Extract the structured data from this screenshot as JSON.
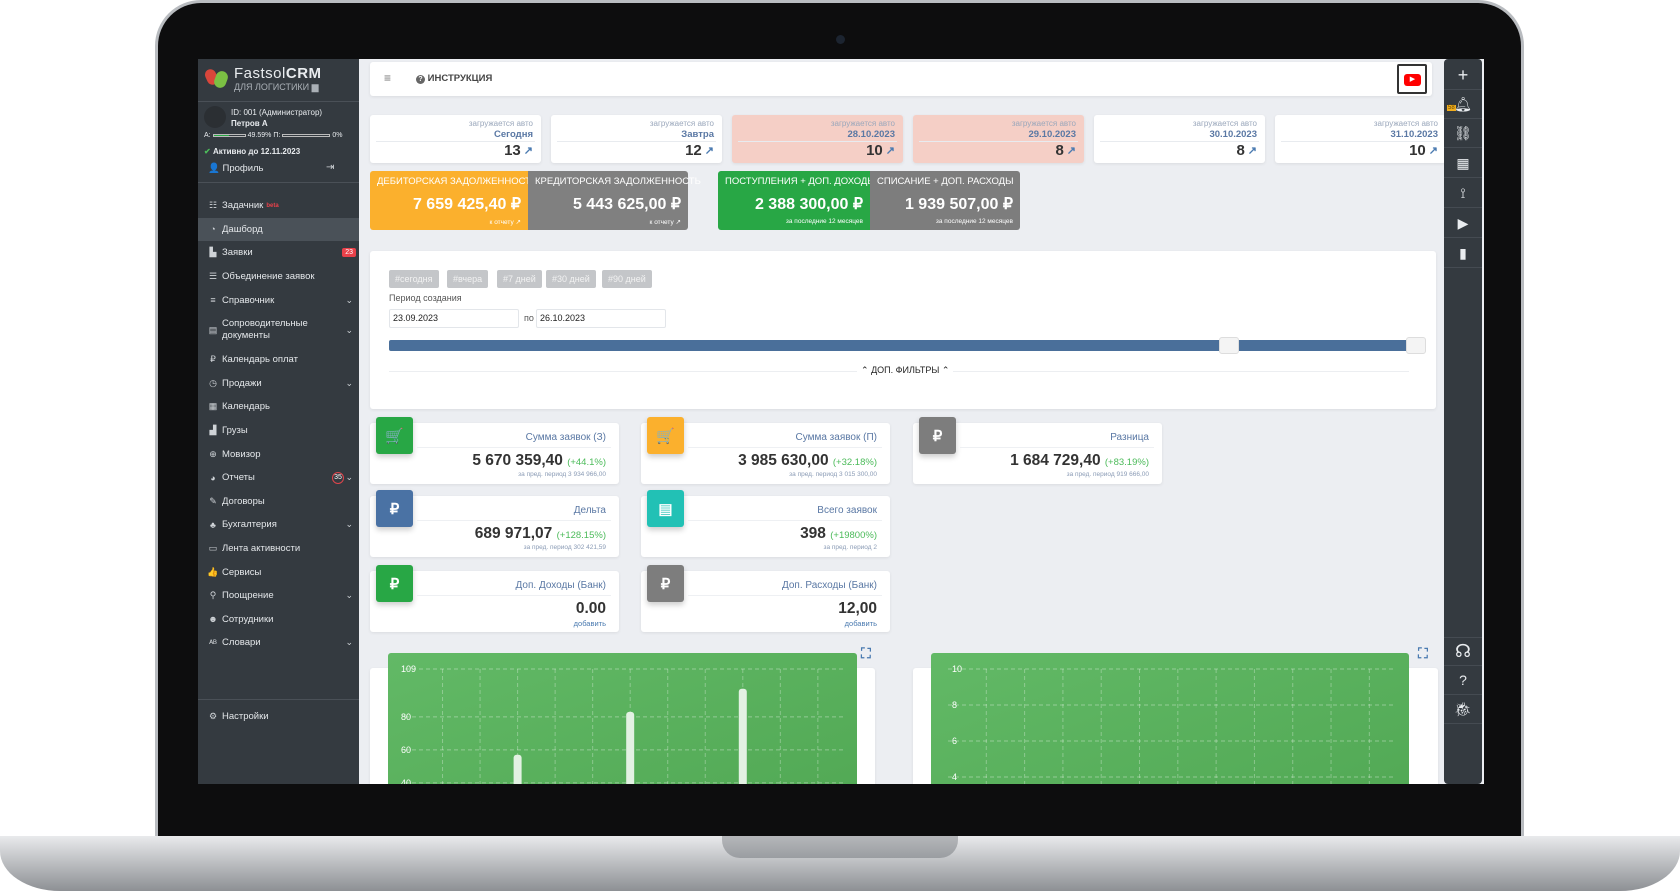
{
  "app": {
    "brand_light": "Fastsol",
    "brand_bold": "CRM",
    "subtitle": "ДЛЯ ЛОГИСТИКИ"
  },
  "user": {
    "id_line": "ID: 001 (Администратор)",
    "name": "Петров А",
    "a_label": "А:",
    "a_value": "49.59%",
    "a_fraction": 0.4959,
    "p_label": "П:",
    "p_value": "0%",
    "p_fraction": 0,
    "active_until": "Активно до 12.11.2023",
    "profile": "Профиль"
  },
  "sidebar": {
    "items": [
      {
        "label": "Задачник",
        "icon": "tasks-icon",
        "glyph": "☷",
        "beta": "beta"
      },
      {
        "label": "Дашборд",
        "icon": "dashboard-icon",
        "glyph": "◔",
        "active": true
      },
      {
        "label": "Заявки",
        "icon": "truck-icon",
        "glyph": "▙",
        "badge": "23"
      },
      {
        "label": "Объединение заявок",
        "icon": "list-icon",
        "glyph": "☰"
      },
      {
        "label": "Справочник",
        "icon": "database-icon",
        "glyph": "≡",
        "chevron": true
      },
      {
        "label": "Сопроводительные документы",
        "icon": "document-icon",
        "glyph": "▤",
        "chevron": true,
        "double": true
      },
      {
        "label": "Календарь оплат",
        "icon": "ruble-icon",
        "glyph": "₽"
      },
      {
        "label": "Продажи",
        "icon": "stopwatch-icon",
        "glyph": "◷",
        "chevron": true
      },
      {
        "label": "Календарь",
        "icon": "calendar-icon",
        "glyph": "▦"
      },
      {
        "label": "Грузы",
        "icon": "cargo-icon",
        "glyph": "▟"
      },
      {
        "label": "Мовизор",
        "icon": "search-plus-icon",
        "glyph": "⊕"
      },
      {
        "label": "Отчеты",
        "icon": "pie-chart-icon",
        "glyph": "◕",
        "chevron": true,
        "badge2": "35"
      },
      {
        "label": "Договоры",
        "icon": "signature-icon",
        "glyph": "✎"
      },
      {
        "label": "Бухгалтерия",
        "icon": "piggy-bank-icon",
        "glyph": "♣",
        "chevron": true
      },
      {
        "label": "Лента активности",
        "icon": "table-icon",
        "glyph": "▭"
      },
      {
        "label": "Сервисы",
        "icon": "thumbs-up-icon",
        "glyph": "👍"
      },
      {
        "label": "Поощрение",
        "icon": "award-icon",
        "glyph": "⚲",
        "chevron": true
      },
      {
        "label": "Сотрудники",
        "icon": "users-icon",
        "glyph": "☻"
      },
      {
        "label": "Словари",
        "icon": "spell-check-icon",
        "glyph": "ᴬᴮ",
        "chevron": true
      }
    ],
    "settings": "Настройки"
  },
  "header": {
    "instruction": "ИНСТРУКЦИЯ"
  },
  "load_cards": [
    {
      "label": "загружается авто",
      "date": "Сегодня",
      "count": "13",
      "highlight": false
    },
    {
      "label": "загружается авто",
      "date": "Завтра",
      "count": "12",
      "highlight": false
    },
    {
      "label": "загружается авто",
      "date": "28.10.2023",
      "count": "10",
      "highlight": true
    },
    {
      "label": "загружается авто",
      "date": "29.10.2023",
      "count": "8",
      "highlight": true
    },
    {
      "label": "загружается авто",
      "date": "30.10.2023",
      "count": "8",
      "highlight": false
    },
    {
      "label": "загружается авто",
      "date": "31.10.2023",
      "count": "10",
      "highlight": false
    }
  ],
  "finance": [
    {
      "title": "ДЕБИТОРСКАЯ ЗАДОЛЖЕННОСТЬ",
      "value": "7 659 425,40 ₽",
      "sub": "к отчету",
      "color": "#fbb02d"
    },
    {
      "title": "КРЕДИТОРСКАЯ ЗАДОЛЖЕННОСТЬ",
      "value": "5 443 625,00 ₽",
      "sub": "к отчету",
      "color": "#808080"
    },
    {
      "title": "ПОСТУПЛЕНИЯ + ДОП. ДОХОДЫ",
      "value": "2 388 300,00 ₽",
      "sub": "за последние 12 месяцев",
      "color": "#28a745"
    },
    {
      "title": "СПИСАНИЕ + ДОП. РАСХОДЫ",
      "value": "1 939 507,00 ₽",
      "sub": "за последние 12 месяцев",
      "color": "#7d7d7d"
    }
  ],
  "filters": {
    "chips": [
      "#сегодня",
      "#вчера",
      "#7 дней",
      "#30 дней",
      "#90 дней"
    ],
    "period_label": "Период создания",
    "from": "23.09.2023",
    "to_label": "по",
    "to": "26.10.2023",
    "range_fraction": [
      0.81,
      1.0
    ],
    "more": "ДОП. ФИЛЬТРЫ"
  },
  "stats": [
    {
      "title": "Сумма заявок (З)",
      "value": "5 670 359,40",
      "pct": "(+44.1%)",
      "sub": "за пред. период 3 934 966,00",
      "icon": "cart-icon",
      "glyph": "🛒",
      "color": "#28a745"
    },
    {
      "title": "Сумма заявок (П)",
      "value": "3 985 630,00",
      "pct": "(+32.18%)",
      "sub": "за пред. период 3 015 300,00",
      "icon": "cart-plus-icon",
      "glyph": "🛒",
      "color": "#fbb02d"
    },
    {
      "title": "Разница",
      "value": "1 684 729,40",
      "pct": "(+83.19%)",
      "sub": "за пред. период 919 666,00",
      "icon": "ruble-icon",
      "glyph": "₽",
      "color": "#7d7d7d"
    },
    {
      "title": "Дельта",
      "value": "689 971,07",
      "pct": "(+128.15%)",
      "sub": "за пред. период 302 421,59",
      "icon": "ruble-icon",
      "glyph": "₽",
      "color": "#4a72a4"
    },
    {
      "title": "Всего заявок",
      "value": "398",
      "pct": "(+19800%)",
      "sub": "за пред. период 2",
      "icon": "file-icon",
      "glyph": "▤",
      "color": "#22c1b5"
    },
    {
      "title": "Доп. Доходы (Банк)",
      "value": "0.00",
      "add": "добавить",
      "icon": "ruble-icon",
      "glyph": "₽",
      "color": "#28a745"
    },
    {
      "title": "Доп. Расходы (Банк)",
      "value": "12,00",
      "add": "добавить",
      "icon": "ruble-icon",
      "glyph": "₽",
      "color": "#7d7d7d"
    }
  ],
  "right_bar": {
    "notifications_count": "58"
  },
  "chart_data": [
    {
      "type": "bar",
      "title": "",
      "xlabel": "",
      "ylabel": "",
      "yticks": [
        "109",
        "80",
        "60",
        "40"
      ],
      "ytick_values": [
        109,
        80,
        60,
        40
      ],
      "ylim": [
        0,
        109
      ],
      "grid": true,
      "n_slots": 12,
      "values": [
        0,
        0,
        0,
        57,
        0,
        0,
        83,
        0,
        0,
        97,
        0,
        0
      ]
    },
    {
      "type": "bar",
      "title": "",
      "xlabel": "",
      "ylabel": "",
      "yticks": [
        "10",
        "8",
        "6",
        "4"
      ],
      "ytick_values": [
        10,
        8,
        6,
        4
      ],
      "ylim": [
        0,
        10
      ],
      "grid": true,
      "n_slots": 12,
      "values": [
        0,
        0,
        0,
        0,
        0,
        0,
        0,
        0,
        0,
        0,
        0,
        0
      ]
    }
  ]
}
